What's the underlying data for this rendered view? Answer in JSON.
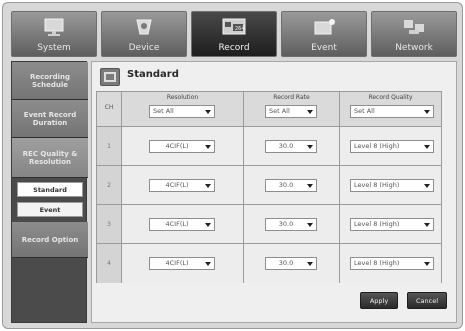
{
  "tabs": [
    {
      "label": "System",
      "icon": "monitor-icon",
      "active": false
    },
    {
      "label": "Device",
      "icon": "camera-icon",
      "active": false
    },
    {
      "label": "Record",
      "icon": "recorder-icon",
      "active": true
    },
    {
      "label": "Event",
      "icon": "event-icon",
      "active": false
    },
    {
      "label": "Network",
      "icon": "network-icon",
      "active": false
    }
  ],
  "sidebar": {
    "items": [
      {
        "label": "Recording Schedule"
      },
      {
        "label": "Event Record Duration"
      },
      {
        "label": "REC Quality & Resolution"
      },
      {
        "label": "Record Option"
      }
    ],
    "subitems": [
      {
        "label": "Standard",
        "selected": true
      },
      {
        "label": "Event",
        "selected": false
      }
    ]
  },
  "panel": {
    "title": "Standard",
    "icon": "film-icon"
  },
  "table": {
    "headers": {
      "ch": "CH",
      "resolution": "Resolution",
      "record_rate": "Record Rate",
      "record_quality": "Record Quality"
    },
    "set_all": {
      "resolution": "Set All",
      "record_rate": "Set All",
      "record_quality": "Set All"
    },
    "rows": [
      {
        "ch": "1",
        "resolution": "4CIF(L)",
        "record_rate": "30.0",
        "record_quality": "Level 8 (High)"
      },
      {
        "ch": "2",
        "resolution": "4CIF(L)",
        "record_rate": "30.0",
        "record_quality": "Level 8 (High)"
      },
      {
        "ch": "3",
        "resolution": "4CIF(L)",
        "record_rate": "30.0",
        "record_quality": "Level 8 (High)"
      },
      {
        "ch": "4",
        "resolution": "4CIF(L)",
        "record_rate": "30.0",
        "record_quality": "Level 8 (High)"
      }
    ]
  },
  "buttons": {
    "apply": "Apply",
    "cancel": "Cancel"
  }
}
